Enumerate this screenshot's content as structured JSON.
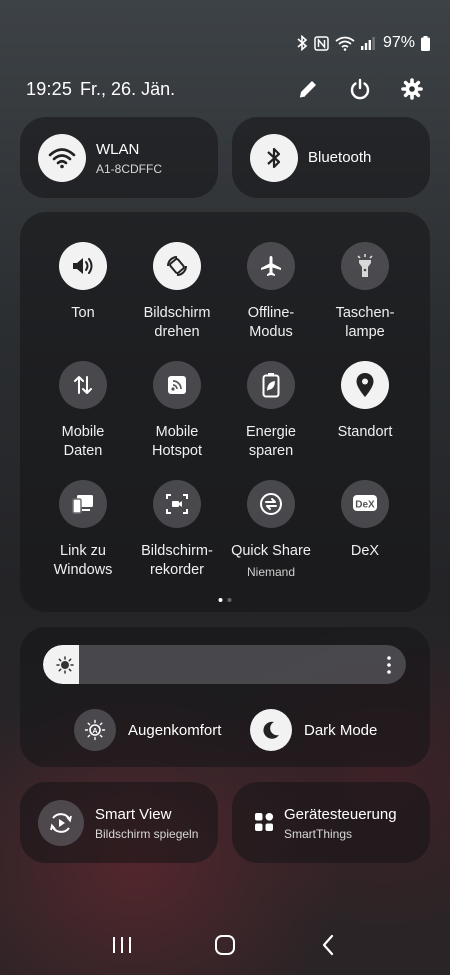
{
  "status": {
    "battery_percent": "97%"
  },
  "header": {
    "time": "19:25",
    "date": "Fr., 26. Jän."
  },
  "wlan": {
    "title": "WLAN",
    "subtitle": "A1-8CDFFC"
  },
  "bluetooth": {
    "title": "Bluetooth"
  },
  "quick_settings": [
    {
      "label": "Ton",
      "icon": "volume-icon",
      "state": "on"
    },
    {
      "label": "Bildschirm\ndrehen",
      "icon": "auto-rotate-icon",
      "state": "on"
    },
    {
      "label": "Offline-\nModus",
      "icon": "airplane-icon",
      "state": "off"
    },
    {
      "label": "Taschen-\nlampe",
      "icon": "flashlight-icon",
      "state": "off"
    },
    {
      "label": "Mobile\nDaten",
      "icon": "mobile-data-icon",
      "state": "off"
    },
    {
      "label": "Mobile\nHotspot",
      "icon": "hotspot-icon",
      "state": "off"
    },
    {
      "label": "Energie\nsparen",
      "icon": "battery-saver-icon",
      "state": "off"
    },
    {
      "label": "Standort",
      "icon": "location-icon",
      "state": "on"
    },
    {
      "label": "Link zu\nWindows",
      "icon": "link-windows-icon",
      "state": "off"
    },
    {
      "label": "Bildschirm-\nrekorder",
      "icon": "screen-recorder-icon",
      "state": "off"
    },
    {
      "label": "Quick Share",
      "sublabel": "Niemand",
      "icon": "quick-share-icon",
      "state": "off"
    },
    {
      "label": "DeX",
      "icon": "dex-icon",
      "state": "off"
    }
  ],
  "page_indicator": {
    "current": 1,
    "total": 2
  },
  "brightness": {
    "level": 0.1
  },
  "eye_comfort": {
    "label": "Augenkomfort"
  },
  "dark_mode": {
    "label": "Dark Mode"
  },
  "smart_view": {
    "title": "Smart View",
    "subtitle": "Bildschirm spiegeln"
  },
  "device_control": {
    "title": "Gerätesteuerung",
    "subtitle": "SmartThings"
  },
  "colors": {
    "active_tile": "#f2f2f2",
    "inactive_tile": "#6e6e72"
  }
}
